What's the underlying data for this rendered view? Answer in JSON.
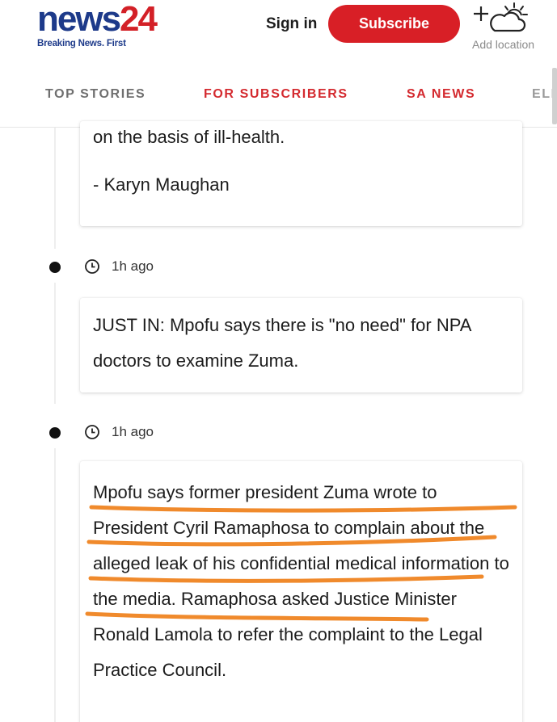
{
  "header": {
    "logo_news": "news",
    "logo_num": "24",
    "tagline": "Breaking News. First",
    "signin_label": "Sign in",
    "subscribe_label": "Subscribe",
    "add_location_label": "Add location",
    "colors": {
      "brand_blue": "#1d3a8a",
      "brand_red": "#d81f26"
    }
  },
  "nav": {
    "tabs": [
      {
        "label": "TOP STORIES",
        "active": false
      },
      {
        "label": "FOR SUBSCRIBERS",
        "active": false
      },
      {
        "label": "SA NEWS",
        "active": true
      },
      {
        "label": "ELE",
        "active": false
      }
    ],
    "accent_color": "#c8152b"
  },
  "feed": {
    "card1": {
      "line1": "on the basis of ill-health.",
      "line2": "- Karyn Maughan"
    },
    "entries": [
      {
        "time": "1h ago",
        "text": "JUST IN: Mpofu says there is \"no need\" for NPA doctors to examine Zuma."
      },
      {
        "time": "1h ago",
        "text": "Mpofu says former president Zuma wrote to President Cyril Ramaphosa to complain about the alleged leak of his confidential medical information to the media. Ramaphosa asked Justice Minister Ronald Lamola to refer the complaint to the Legal Practice Council."
      }
    ],
    "highlight_color": "#f08a2c"
  }
}
